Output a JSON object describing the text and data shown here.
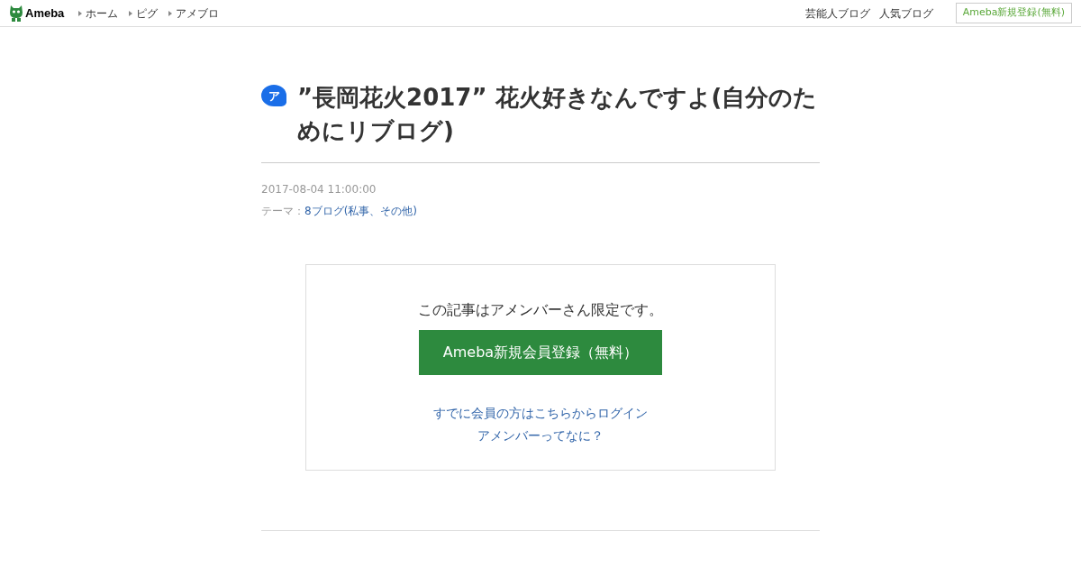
{
  "header": {
    "logo": "Ameba",
    "nav": [
      "ホーム",
      "ピグ",
      "アメブロ"
    ],
    "right_links": [
      "芸能人ブログ",
      "人気ブログ"
    ],
    "signup": "Ameba新規登録(無料)"
  },
  "article": {
    "badge": "ア",
    "title": "”長岡花火2017” 花火好きなんですよ(自分のためにリブログ)",
    "date": "2017-08-04 11:00:00",
    "theme_label": "テーマ：",
    "theme": "8ブログ(私事、その他)"
  },
  "members_box": {
    "message": "この記事はアメンバーさん限定です。",
    "button": "Ameba新規会員登録（無料）",
    "links": [
      "すでに会員の方はこちらからログイン",
      "アメンバーってなに？"
    ]
  }
}
